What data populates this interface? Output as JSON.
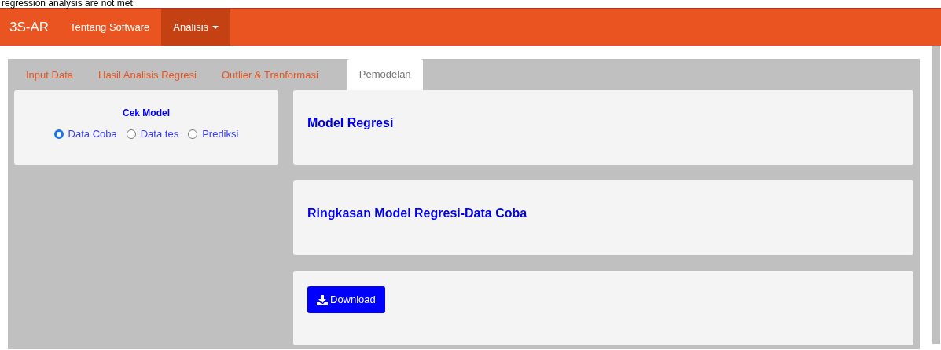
{
  "page_caption": "regression analysis are not met.",
  "navbar": {
    "brand": "3S-AR",
    "items": [
      {
        "label": "Tentang Software",
        "selected": false,
        "dropdown": false
      },
      {
        "label": "Analisis",
        "selected": true,
        "dropdown": true
      }
    ]
  },
  "tabs": [
    {
      "label": "Input Data",
      "selected": false
    },
    {
      "label": "Hasil Analisis Regresi",
      "selected": false
    },
    {
      "label": "Outlier & Tranformasi",
      "selected": false
    },
    {
      "label": "Pemodelan",
      "selected": true
    }
  ],
  "sidebar": {
    "title": "Cek Model",
    "options": [
      {
        "label": "Data Coba",
        "selected": true
      },
      {
        "label": "Data tes",
        "selected": false
      },
      {
        "label": "Prediksi",
        "selected": false
      }
    ]
  },
  "panels": [
    {
      "kind": "heading",
      "title": "Model Regresi"
    },
    {
      "kind": "heading",
      "title": "Ringkasan Model Regresi-Data Coba"
    },
    {
      "kind": "button",
      "label": "Download"
    }
  ]
}
